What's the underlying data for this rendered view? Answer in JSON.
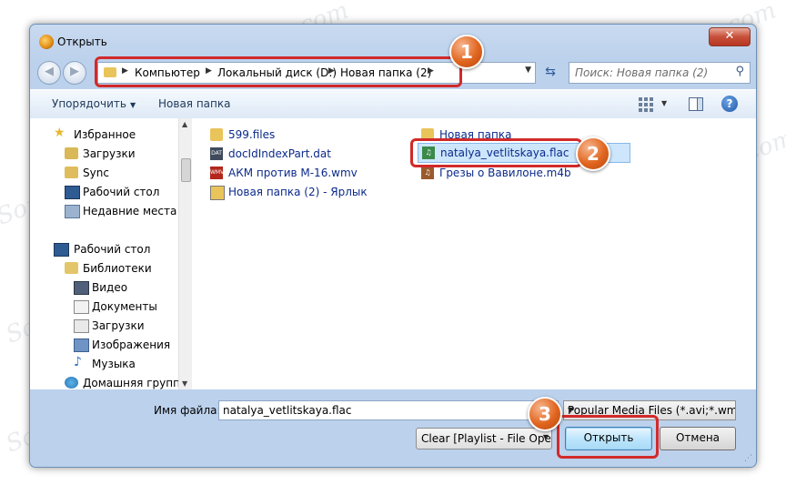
{
  "window": {
    "title": "Открыть",
    "close_label": "✕"
  },
  "address_bar": {
    "crumbs": [
      "Компьютер",
      "Локальный диск (D:)",
      "Новая папка (2)"
    ],
    "search_placeholder": "Поиск: Новая папка (2)"
  },
  "toolbar": {
    "organize_label": "Упорядочить",
    "new_folder_label": "Новая папка"
  },
  "nav_pane": {
    "favorites": "Избранное",
    "downloads": "Загрузки",
    "sync": "Sync",
    "desktop": "Рабочий стол",
    "recent": "Недавние места",
    "desktop2": "Рабочий стол",
    "libraries": "Библиотеки",
    "video": "Видео",
    "documents": "Документы",
    "downloads2": "Загрузки",
    "images": "Изображения",
    "music": "Музыка",
    "homegroup": "Домашняя группа"
  },
  "files": [
    {
      "name": "599.files",
      "icon": "folder-icon"
    },
    {
      "name": "docIdIndexPart.dat",
      "icon": "dat-file-icon"
    },
    {
      "name": "АКМ против М-16.wmv",
      "icon": "video-file-icon"
    },
    {
      "name": "Новая папка (2) - Ярлык",
      "icon": "shortcut-icon"
    },
    {
      "name": "Новая папка",
      "icon": "folder-icon"
    },
    {
      "name": "natalya_vetlitskaya.flac",
      "icon": "audio-file-icon"
    },
    {
      "name": "Грезы о Вавилоне.m4b",
      "icon": "audio-book-icon"
    }
  ],
  "bottom": {
    "filename_label": "Имя файла:",
    "filename_value": "natalya_vetlitskaya.flac",
    "filetype_value": "Popular Media Files (*.avi;*.wm",
    "playlist_value": "Clear [Playlist - File Ope",
    "open_label": "Открыть",
    "cancel_label": "Отмена"
  },
  "annotations": {
    "badge1": "1",
    "badge2": "2",
    "badge3": "3"
  },
  "colors": {
    "highlight": "#d12a2a",
    "badge": "#e0651f",
    "selection": "#cde6fb"
  }
}
